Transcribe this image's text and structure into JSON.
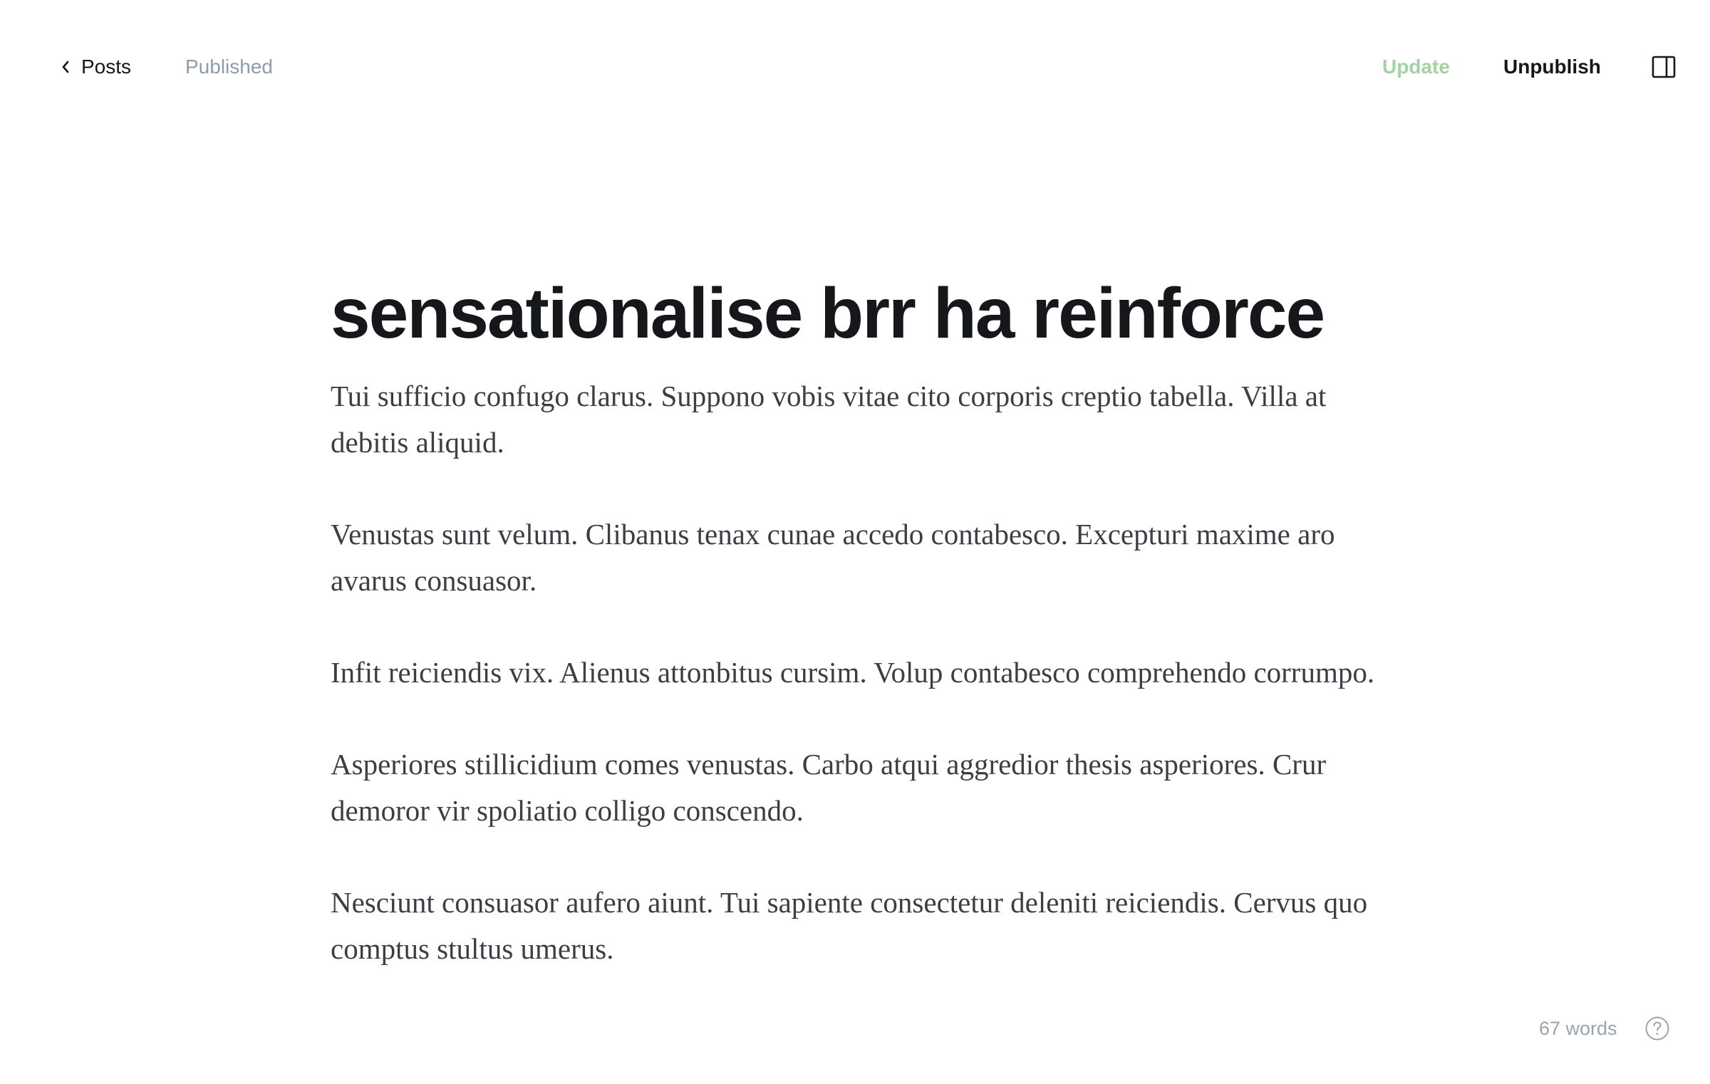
{
  "header": {
    "back_label": "Posts",
    "back_icon": "chevron-left-icon",
    "status": "Published",
    "update_label": "Update",
    "unpublish_label": "Unpublish",
    "sidebar_icon": "sidebar-toggle-icon"
  },
  "post": {
    "title": "sensationalise brr ha reinforce",
    "paragraphs": [
      "Tui sufficio confugo clarus. Suppono vobis vitae cito corporis creptio tabella. Villa at debitis aliquid.",
      "Venustas sunt velum. Clibanus tenax cunae accedo contabesco. Excepturi maxime aro avarus consuasor.",
      "Infit reiciendis vix. Alienus attonbitus cursim. Volup contabesco comprehendo corrumpo.",
      "Asperiores stillicidium comes venustas. Carbo atqui aggredior thesis asperiores. Crur demoror vir spoliatio colligo conscendo.",
      "Nesciunt consuasor aufero aiunt. Tui sapiente consectetur deleniti reiciendis. Cervus quo comptus stultus umerus."
    ]
  },
  "footer": {
    "word_count": "67 words",
    "help_icon": "help-icon"
  },
  "colors": {
    "text_primary": "#15171a",
    "text_body": "#3b3f44",
    "text_muted": "#8e9cac",
    "update_green": "#a4d3a1",
    "background": "#ffffff"
  }
}
